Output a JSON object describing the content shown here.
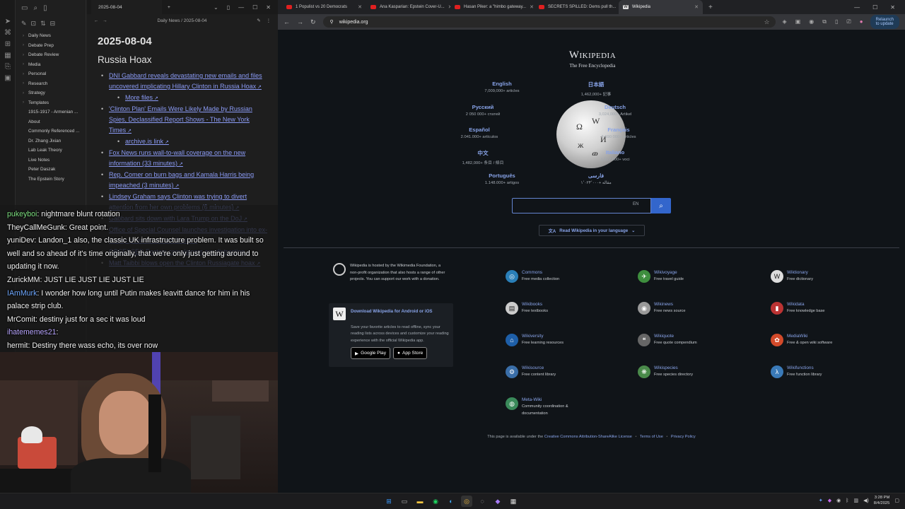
{
  "obsidian": {
    "sidebar_items": [
      {
        "label": "Daily News",
        "folder": true
      },
      {
        "label": "Debate Prep",
        "folder": true
      },
      {
        "label": "Debate Review",
        "folder": true
      },
      {
        "label": "Media",
        "folder": true
      },
      {
        "label": "Personal",
        "folder": true
      },
      {
        "label": "Research",
        "folder": true
      },
      {
        "label": "Strategy",
        "folder": true
      },
      {
        "label": "Templates",
        "folder": true
      },
      {
        "label": "1915-1917 - Armenian ...",
        "folder": false
      },
      {
        "label": "About",
        "folder": false
      },
      {
        "label": "Commonly Referenced ...",
        "folder": false
      },
      {
        "label": "Dr. Zhang Jixian",
        "folder": false
      },
      {
        "label": "Lab Leak Theory",
        "folder": false
      },
      {
        "label": "Live Notes",
        "folder": false
      },
      {
        "label": "Peter Daszak",
        "folder": false
      },
      {
        "label": "The Epstein Story",
        "folder": false
      }
    ],
    "tab_title": "2025-08-04",
    "breadcrumb": "Daily News / 2025-08-04",
    "note_date": "2025-08-04",
    "note_heading": "Russia Hoax",
    "links": [
      {
        "text": "DNI Gabbard reveals devastating new emails and files uncovered implicating Hillary Clinton in Russia Hoax",
        "sub": false
      },
      {
        "text": "More files",
        "sub": true
      },
      {
        "text": "'Clinton Plan' Emails Were Likely Made by Russian Spies, Declassified Report Shows - The New York Times",
        "sub": false
      },
      {
        "text": "archive.is link",
        "sub": true
      },
      {
        "text": "Fox News runs wall-to-wall coverage on the new information (33 minutes)",
        "sub": false
      },
      {
        "text": "Rep. Comer on burn bags and Kamala Harris being impeached (3 minutes)",
        "sub": false
      },
      {
        "text": "Lindsey Graham says Clinton was trying to divert attention from her own problems (6 minutes)",
        "sub": false
      },
      {
        "text": "Gabbard sits down with Lara Trump on the DoJ",
        "sub": false
      },
      {
        "text": "Office of Special Counsel launches investigation into ex-Trump prosecutor Jack Smith",
        "sub": false
      },
      {
        "text": "OBSESSED Epstein complainers are distracting",
        "sub": false
      },
      {
        "text": "Matt Taibbi blows open the Clinton Russiagate hoax",
        "sub": false
      }
    ]
  },
  "chat": [
    {
      "user": "pukeyboi",
      "color": "#7ee081",
      "text": "nightmare blunt rotation"
    },
    {
      "user": "TheyCallMeGunk",
      "color": "#f2f2f2",
      "text": "Great point."
    },
    {
      "user": "yuniDev",
      "color": "#f2f2f2",
      "text": "Landon_1 also, the classic UK infrastructure problem. It was built so well and so ahead of it's time originally, that we're only just getting around to updating it now."
    },
    {
      "user": "ZurickMM",
      "color": "#f2f2f2",
      "text": "JUST LIE JUST LIE JUST LIE"
    },
    {
      "user": "IAmMurk",
      "color": "#6fa8ff",
      "text": "I wonder how long until Putin makes leavitt dance for him in his palace strip club."
    },
    {
      "user": "MrComit",
      "color": "#f2f2f2",
      "text": "destiny just for a sec it was loud"
    },
    {
      "user": "ihatememes21",
      "color": "#b9a6ff",
      "text": ""
    },
    {
      "user": "hermit",
      "color": "#f2f2f2",
      "text": "Destiny there wass echo, its over now"
    }
  ],
  "browser": {
    "tabs": [
      {
        "title": "1 Populist vs 20 Democrats",
        "active": false,
        "favicon": "youtube"
      },
      {
        "title": "Ana Kasparian: Epstein Cover-U...",
        "active": false,
        "favicon": "youtube"
      },
      {
        "title": "Hasan Piker: a \"himbo gateway...",
        "active": false,
        "favicon": "youtube"
      },
      {
        "title": "SECRETS SPILLED: Dems pull th...",
        "active": false,
        "favicon": "youtube"
      },
      {
        "title": "Wikipedia",
        "active": true,
        "favicon": "wikipedia"
      }
    ],
    "url": "wikipedia.org",
    "relaunch_label": "Relaunch to update"
  },
  "wiki": {
    "wordmark": "Wikipedia",
    "tagline": "The Free Encyclopedia",
    "languages": [
      {
        "name": "English",
        "count": "7,009,000+ articles"
      },
      {
        "name": "日本語",
        "count": "1,462,000+ 記事"
      },
      {
        "name": "Русский",
        "count": "2 050 000+ статей"
      },
      {
        "name": "Deutsch",
        "count": "3,024,000+ Artikel"
      },
      {
        "name": "Español",
        "count": "2.041.000+ artículos"
      },
      {
        "name": "Français",
        "count": "2 690 000+ articles"
      },
      {
        "name": "中文",
        "count": "1,482,000+ 条目 / 條目"
      },
      {
        "name": "Italiano",
        "count": "1.922.000+ voci"
      },
      {
        "name": "Português",
        "count": "1.148.000+ artigos"
      },
      {
        "name": "فارسی",
        "count": "۱٬۰۲۴٬۰۰۰+ مقاله"
      }
    ],
    "search_value": "",
    "search_lang": "EN",
    "read_lang_label": "Read Wikipedia in your language",
    "hosted_text": "Wikipedia is hosted by the Wikimedia Foundation, a non-profit organization that also hosts a range of other projects.",
    "donation_text": "You can support our work with a donation.",
    "app_title": "Download Wikipedia for Android or iOS",
    "app_desc": "Save your favorite articles to read offline, sync your reading lists across devices and customize your reading experience with the official Wikipedia app.",
    "google_play": "Google Play",
    "app_store": "App Store",
    "projects": [
      {
        "name": "Commons",
        "desc": "Free media collection",
        "color": "#2a7fb8",
        "glyph": "◎"
      },
      {
        "name": "Wikivoyage",
        "desc": "Free travel guide",
        "color": "#3e8e3e",
        "glyph": "✈"
      },
      {
        "name": "Wiktionary",
        "desc": "Free dictionary",
        "color": "#ddd",
        "glyph": "W"
      },
      {
        "name": "Wikibooks",
        "desc": "Free textbooks",
        "color": "#ccc",
        "glyph": "▤"
      },
      {
        "name": "Wikinews",
        "desc": "Free news source",
        "color": "#999",
        "glyph": "◉"
      },
      {
        "name": "Wikidata",
        "desc": "Free knowledge base",
        "color": "#b33",
        "glyph": "▮"
      },
      {
        "name": "Wikiversity",
        "desc": "Free learning resources",
        "color": "#1e5fa8",
        "glyph": "⌂"
      },
      {
        "name": "Wikiquote",
        "desc": "Free quote compendium",
        "color": "#666",
        "glyph": "❝"
      },
      {
        "name": "MediaWiki",
        "desc": "Free & open wiki software",
        "color": "#d34a2a",
        "glyph": "✿"
      },
      {
        "name": "Wikisource",
        "desc": "Free content library",
        "color": "#3a6ea8",
        "glyph": "⚙"
      },
      {
        "name": "Wikispecies",
        "desc": "Free species directory",
        "color": "#4a8a4a",
        "glyph": "❋"
      },
      {
        "name": "Wikifunctions",
        "desc": "Free function library",
        "color": "#3a7ab8",
        "glyph": "λ"
      },
      {
        "name": "Meta-Wiki",
        "desc": "Community coordination & documentation",
        "color": "#3a8a5a",
        "glyph": "◍"
      }
    ],
    "footer_prefix": "This page is available under the",
    "footer_license": "Creative Commons Attribution-ShareAlike License",
    "footer_terms": "Terms of Use",
    "footer_privacy": "Privacy Policy"
  },
  "taskbar": {
    "time": "3:28 PM",
    "date": "8/4/2025"
  }
}
